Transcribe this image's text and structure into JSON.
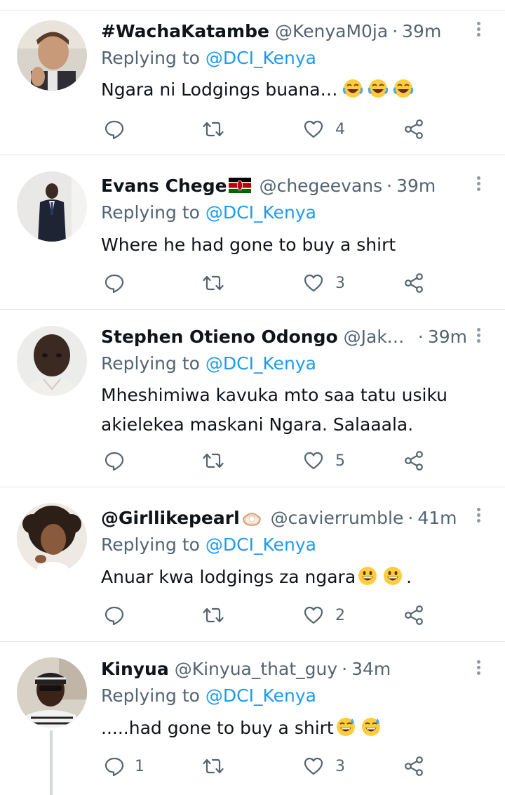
{
  "tweets": [
    {
      "name": "#WachaKatambe",
      "handle": "@KenyaM0ja",
      "time": "39m",
      "reply_label": "Replying to",
      "reply_to": "@DCI_Kenya",
      "text": "Ngara ni Lodgings buana…",
      "emoji": [
        "laughing-tears-emoji",
        "laughing-tears-emoji",
        "laughing-tears-emoji"
      ],
      "replies": "",
      "likes": "4"
    },
    {
      "name": "Evans Chege",
      "handle": "@chegeevans",
      "time": "39m",
      "reply_label": "Replying to",
      "reply_to": "@DCI_Kenya",
      "text": "Where he had gone to buy a shirt",
      "emoji": [],
      "replies": "",
      "likes": "3"
    },
    {
      "name": "Stephen Otieno Odongo",
      "handle": "@Jaka...",
      "time": "39m",
      "reply_label": "Replying to",
      "reply_to": "@DCI_Kenya",
      "text": "Mheshimiwa kavuka mto saa tatu usiku akielekea maskani Ngara. Salaaala.",
      "emoji": [],
      "replies": "",
      "likes": "5"
    },
    {
      "name": "@Girllikepearl",
      "handle": "@cavierrumble",
      "time": "41m",
      "reply_label": "Replying to",
      "reply_to": "@DCI_Kenya",
      "text": "Anuar kwa lodgings za ngara",
      "text_end": ".",
      "emoji": [
        "grinning-emoji",
        "grinning-emoji"
      ],
      "replies": "",
      "likes": "2"
    },
    {
      "name": "Kinyua",
      "handle": "@Kinyua_that_guy",
      "time": "34m",
      "reply_label": "Replying to",
      "reply_to": "@DCI_Kenya",
      "text": ".....had gone to buy a shirt",
      "emoji": [
        "sweat-smile-emoji",
        "sweat-smile-emoji"
      ],
      "replies": "1",
      "likes": "3"
    }
  ],
  "colors": {
    "link": "#1d9bf0",
    "secondary": "#536471",
    "divider": "#e1e6ea"
  }
}
